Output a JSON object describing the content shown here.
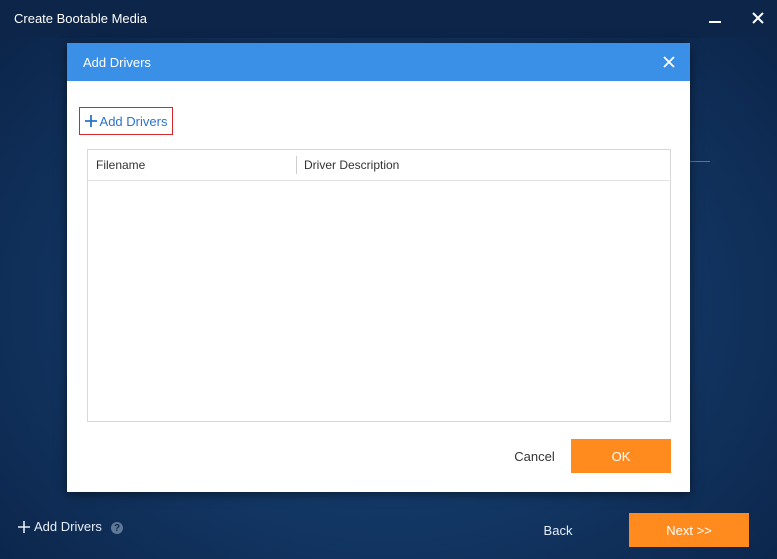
{
  "window": {
    "title": "Create Bootable Media",
    "minimize_icon": "minimize-icon",
    "close_icon": "close-icon"
  },
  "footer": {
    "add_drivers_label": "Add Drivers",
    "add_icon": "plus-icon",
    "help_icon": "question-icon",
    "help_glyph": "?",
    "back_label": "Back",
    "next_label": "Next >>"
  },
  "dialog": {
    "title": "Add Drivers",
    "close_icon": "close-icon",
    "add_drivers_label": "Add Drivers",
    "add_icon": "plus-icon",
    "table": {
      "columns": [
        "Filename",
        "Driver Description"
      ],
      "rows": []
    },
    "cancel_label": "Cancel",
    "ok_label": "OK"
  },
  "colors": {
    "dialog_header": "#3a8fe6",
    "primary_button": "#ff8a1e",
    "highlight_border": "#d9262b",
    "link_text": "#2a74c9"
  }
}
